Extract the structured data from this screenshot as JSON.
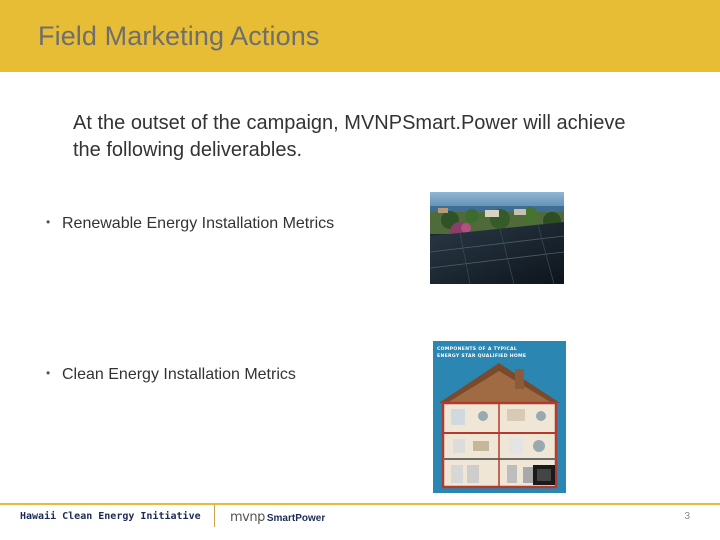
{
  "slide": {
    "title": "Field Marketing Actions",
    "intro": "At the outset of the campaign, MVNPSmart.Power will achieve the following deliverables.",
    "bullets": [
      "Renewable Energy Installation Metrics",
      "Clean Energy Installation Metrics"
    ],
    "poster_caption": "COMPONENTS OF A TYPICAL ENERGY STAR QUALIFIED HOME"
  },
  "footer": {
    "left_text": "Hawaii Clean Energy Initiative",
    "logo_mvnp": "mvnp",
    "logo_smartpower": "SmartPower",
    "page_number": "3"
  },
  "colors": {
    "accent": "#e6bd35",
    "navy": "#1d2c57",
    "body_text": "#333333",
    "title_text": "#6e6e6e"
  }
}
